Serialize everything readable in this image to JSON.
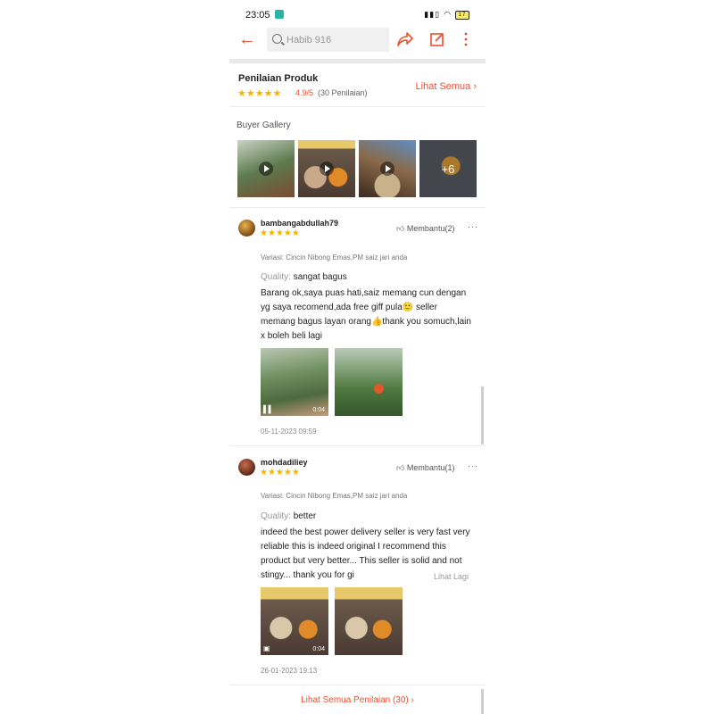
{
  "status_bar": {
    "time": "23:05",
    "indicators": "5G · Wi-Fi · signal",
    "battery": "17"
  },
  "topbar": {
    "search_placeholder": "Habib 916",
    "icons": [
      "back-arrow-icon",
      "search-icon",
      "share-icon",
      "edit-icon",
      "more-vertical-icon"
    ]
  },
  "rating_summary": {
    "title": "Penilaian Produk",
    "stars": "★★★★★",
    "score": "4.9/5",
    "count": "(30 Penilaian)",
    "see_all": "Lihat Semua ›"
  },
  "gallery": {
    "title": "Buyer Gallery",
    "more_count": "+6"
  },
  "reviews": [
    {
      "username": "bambangabdullah79",
      "stars": "★★★★★",
      "helpful": "Membantu(2)",
      "variant": "Variasi: Cincin Nibong Emas,PM saiz jari anda",
      "quality_label": "Quality:",
      "quality_value": "sangat bagus",
      "text": "Barang ok,saya puas hati,saiz memang cun dengan yg saya recomend,ada free giff pula🙂 seller memang bagus layan orang👍thank you somuch,lain x boleh beli lagi",
      "video_duration": "0:04",
      "date": "05-11-2023 09:59"
    },
    {
      "username": "mohdadiliey",
      "stars": "★★★★★",
      "helpful": "Membantu(1)",
      "variant": "Variasi: Cincin Nibong Emas,PM saiz jari anda",
      "quality_label": "Quality:",
      "quality_value": "better",
      "text": "indeed the best power delivery seller is very fast very reliable this is indeed original I recommend this product but very better... This seller is solid and not stingy... thank you for gi",
      "video_duration": "0:04",
      "date": "26-01-2023 19:13",
      "see_more": "Lihat Lagi"
    }
  ],
  "footer": {
    "see_all_reviews": "Lihat Semua Penilaian (30) ›"
  },
  "colors": {
    "accent": "#ee4d2d",
    "star": "#f5b400"
  }
}
